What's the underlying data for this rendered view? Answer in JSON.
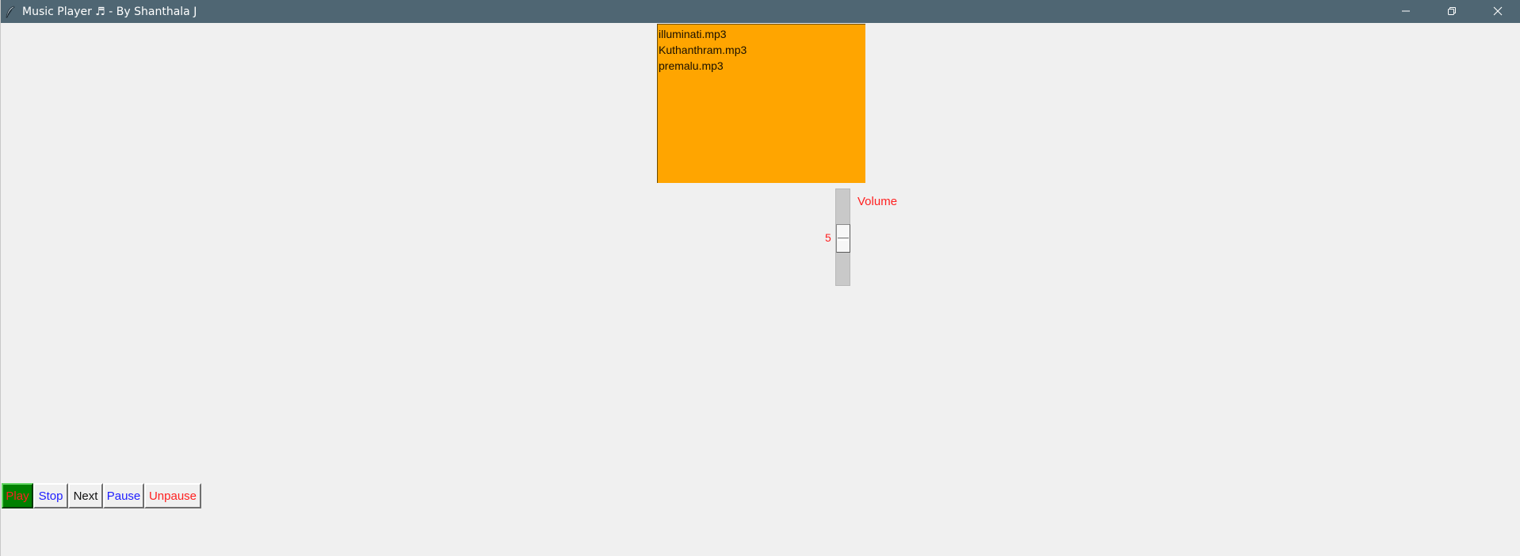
{
  "window": {
    "title": "Music Player ♬ - By Shanthala J",
    "controls": {
      "minimize_icon": "minimize-icon",
      "restore_icon": "restore-icon",
      "close_icon": "close-icon"
    },
    "titlebar_color": "#4f6673"
  },
  "playlist": {
    "background": "#ffa500",
    "items": [
      {
        "label": "illuminati.mp3"
      },
      {
        "label": "Kuthanthram.mp3"
      },
      {
        "label": "premalu.mp3"
      }
    ]
  },
  "volume": {
    "label": "Volume",
    "value": "5",
    "label_color": "#ff2020"
  },
  "controls": {
    "play": {
      "label": "Play",
      "bg": "#008000",
      "fg": "#ff2020"
    },
    "stop": {
      "label": "Stop",
      "fg": "#2020ff"
    },
    "next": {
      "label": "Next",
      "fg": "#111111"
    },
    "pause": {
      "label": "Pause",
      "fg": "#2020ff"
    },
    "unpause": {
      "label": "Unpause",
      "fg": "#ff2020"
    }
  }
}
